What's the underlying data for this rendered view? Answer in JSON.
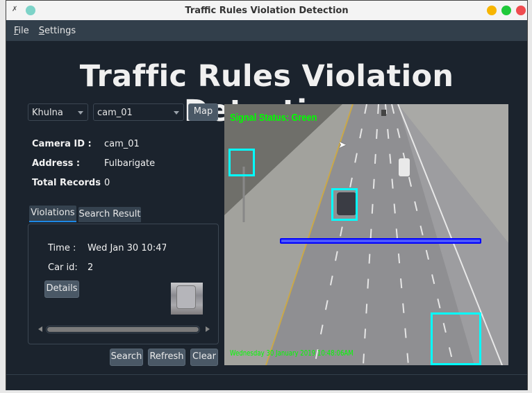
{
  "window": {
    "title": "Traffic Rules Violation Detection"
  },
  "menu": [
    {
      "label": "File",
      "mnemonic": "F",
      "rest": "ile"
    },
    {
      "label": "Settings",
      "mnemonic": "S",
      "rest": "ettings"
    }
  ],
  "header": {
    "title": "Traffic Rules Violation Detection"
  },
  "controls": {
    "region": "Khulna",
    "camera": "cam_01",
    "map_label": "Map"
  },
  "info": {
    "camera_id_label": "Camera ID :",
    "camera_id": "cam_01",
    "address_label": "Address :",
    "address": "Fulbarigate",
    "records_label": "Total Records",
    "records": "0"
  },
  "tabs": [
    {
      "label": "Violations",
      "active": true
    },
    {
      "label": "Search Result",
      "active": false
    }
  ],
  "violation": {
    "time_label": "Time :",
    "time": "Wed Jan 30 10:47:!",
    "car_label": "Car id:",
    "car_id": "2",
    "details_label": "Details"
  },
  "buttons": {
    "search": "Search",
    "refresh": "Refresh",
    "clear": "Clear"
  },
  "video": {
    "signal": "Signal Status: Green",
    "timestamp": "Wednesday 30 January 2019 10:48:06AM",
    "overlay_color": "#00ff00",
    "box_color": "#00ffff",
    "line_color": "#0000ff"
  },
  "colors": {
    "accent": "#1e88e5",
    "background": "#1b232d",
    "menubar": "#323f4b"
  }
}
